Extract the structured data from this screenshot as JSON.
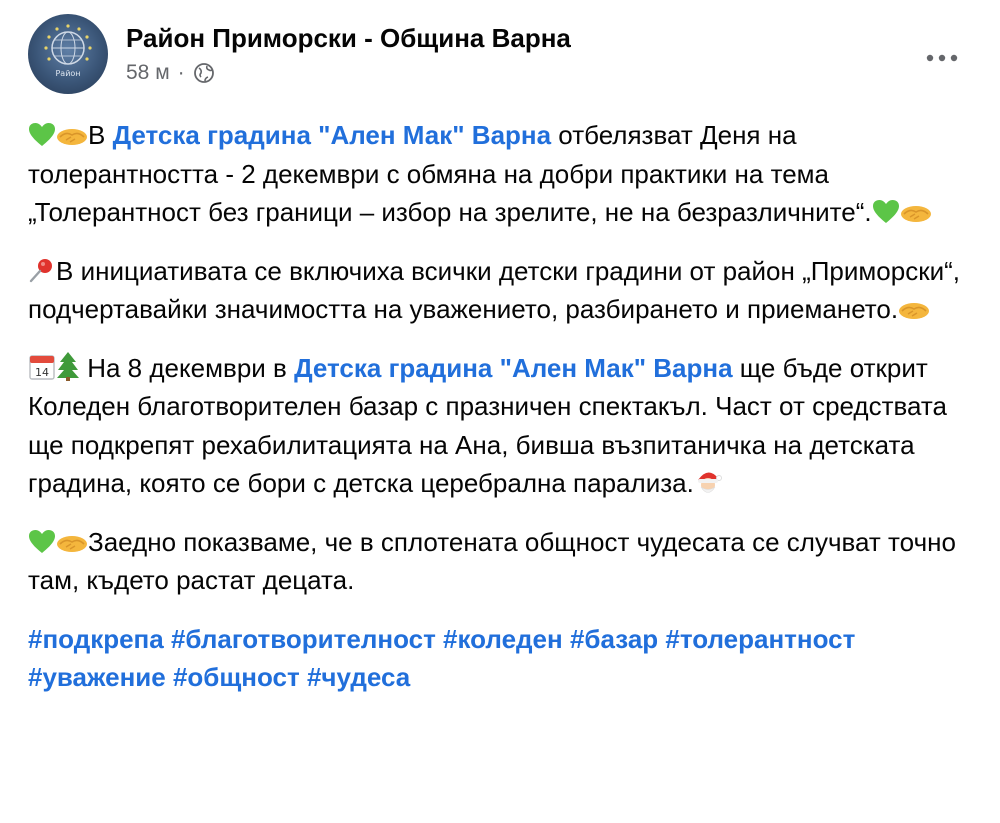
{
  "post": {
    "page_name": "Район Приморски - Община Варна",
    "time": "58 м",
    "separator": "·",
    "avatar_text": "Район",
    "more_icon": "more-dots-icon",
    "privacy_icon": "globe-icon"
  },
  "paragraphs": {
    "p1": {
      "before": "В ",
      "link": "Детска градина \"Ален Мак\" Варна",
      "after": " отбелязват  Деня на толерантността - 2 декември с обмяна на добри практики на тема „Толерантност без граници – избор на зрелите, не на безразличните“."
    },
    "p2": {
      "text": "В инициативата се включиха всички детски градини от район „Приморски“, подчертавайки значимостта на уважението, разбирането и приемането."
    },
    "p3": {
      "before": " На 8 декември в ",
      "link": "Детска градина \"Ален Мак\" Варна",
      "after": " ще бъде открит Коледен благотворителен базар с празничен спектакъл. Част от средствата ще подкрепят рехабилитацията на Ана, бивша възпитаничка на детската градина, която се бори с детска церебрална парализа."
    },
    "p4": {
      "text": "Заедно показваме, че в сплотената общност чудесата се случват точно там, където растат децата."
    }
  },
  "hashtags": [
    "#подкрепа",
    "#благотворителност",
    "#коледен",
    "#базар",
    "#толерантност",
    "#уважение",
    "#общност",
    "#чудеса"
  ],
  "colors": {
    "link": "#216fdb",
    "text": "#050505",
    "secondary": "#65676b",
    "heart": "#5cc547",
    "hands": "#f4b63d"
  },
  "emoji": {
    "calendar_day": "14"
  }
}
